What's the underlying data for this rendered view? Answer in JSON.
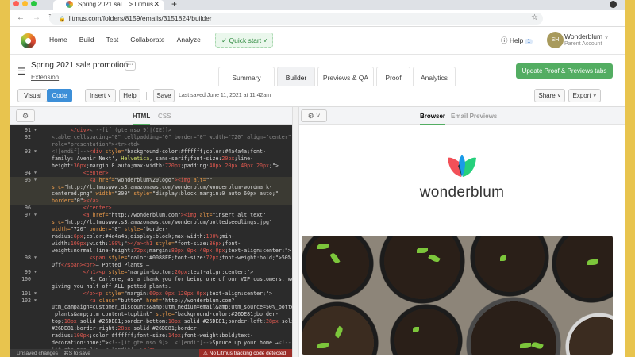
{
  "browser": {
    "tab_title": "Spring 2021 sal... > Litmus",
    "url": "litmus.com/folders/8159/emails/3151824/builder"
  },
  "header": {
    "nav": [
      "Home",
      "Build",
      "Test",
      "Collaborate",
      "Analyze"
    ],
    "quick_start": "Quick start",
    "help": "Help",
    "help_count": "1",
    "avatar_initials": "SH",
    "account_name": "Wonderblum",
    "account_type": "Parent Account"
  },
  "email": {
    "title": "Spring 2021 sale promotion",
    "more": "···",
    "extension": "Extension",
    "tabs": [
      "Summary",
      "Builder",
      "Previews & QA",
      "Proof",
      "Analytics"
    ],
    "active_tab": "Builder",
    "update_button": "Update Proof & Previews tabs"
  },
  "toolbar": {
    "visual": "Visual",
    "code": "Code",
    "insert": "Insert",
    "help": "Help",
    "save": "Save",
    "last_saved": "Last saved June 11, 2021 at 11:42am",
    "share": "Share",
    "export": "Export"
  },
  "editor": {
    "tabs": [
      "HTML",
      "CSS"
    ],
    "active_tab": "HTML",
    "lines": [
      {
        "n": "91",
        "f": true,
        "seg": [
          [
            "p",
            "      "
          ],
          [
            "t",
            "</div>"
          ],
          [
            "c",
            "<!--[if (gte mso 9)|(IE)]>"
          ]
        ]
      },
      {
        "n": "92",
        "seg": [
          [
            "c",
            "<table cellspacing=\"0\" cellpadding=\"0\" border=\"0\" width=\"720\" align=\"center\""
          ]
        ]
      },
      {
        "seg": [
          [
            "c",
            "role=\"presentation\"><tr><td>"
          ]
        ]
      },
      {
        "n": "93",
        "f": true,
        "seg": [
          [
            "c",
            "<![endif]-->"
          ],
          [
            "t",
            "<div "
          ],
          [
            "a",
            "style="
          ],
          [
            "s",
            "\"background-color:#ffffff;color:#4a4a4a;font-"
          ]
        ]
      },
      {
        "seg": [
          [
            "s",
            "family:'Avenir Next', "
          ],
          [
            "g",
            "Helvetica"
          ],
          [
            "s",
            ", sans-serif;font-size:"
          ],
          [
            "v",
            "20px"
          ],
          [
            "s",
            ";line-"
          ]
        ]
      },
      {
        "seg": [
          [
            "s",
            "height:"
          ],
          [
            "v",
            "36px"
          ],
          [
            "s",
            ";margin:0 auto;max-width:"
          ],
          [
            "v",
            "720px"
          ],
          [
            "s",
            ";padding:"
          ],
          [
            "v",
            "40px 20px 40px 20px"
          ],
          [
            "s",
            ";\">"
          ]
        ]
      },
      {
        "n": "94",
        "f": true,
        "seg": [
          [
            "p",
            "          "
          ],
          [
            "t",
            "<center>"
          ]
        ]
      },
      {
        "n": "95",
        "f": true,
        "hl": true,
        "seg": [
          [
            "p",
            "            "
          ],
          [
            "t",
            "<a "
          ],
          [
            "a",
            "href="
          ],
          [
            "s",
            "\"wonderblum%20logo\""
          ],
          [
            "t",
            "><img "
          ],
          [
            "a",
            "alt="
          ],
          [
            "s",
            "\"\""
          ]
        ]
      },
      {
        "hl": true,
        "seg": [
          [
            "a",
            "src="
          ],
          [
            "s",
            "\"http://litmuswww.s3.amazonaws.com/wonderblum/wonderblum-wordmark-"
          ]
        ]
      },
      {
        "hl": true,
        "seg": [
          [
            "s",
            "centered.png\" "
          ],
          [
            "a",
            "width="
          ],
          [
            "s",
            "\"300\" "
          ],
          [
            "a",
            "style="
          ],
          [
            "s",
            "\"display:block;margin:0 auto 60px auto;\""
          ]
        ]
      },
      {
        "hl": true,
        "seg": [
          [
            "a",
            "border="
          ],
          [
            "s",
            "\"0\""
          ],
          [
            "t",
            "></a>"
          ]
        ]
      },
      {
        "n": "96",
        "seg": [
          [
            "p",
            "          "
          ],
          [
            "t",
            "</center>"
          ]
        ]
      },
      {
        "n": "97",
        "f": true,
        "seg": [
          [
            "p",
            "          "
          ],
          [
            "t",
            "<a "
          ],
          [
            "a",
            "href="
          ],
          [
            "s",
            "\"http://wonderblum.com\""
          ],
          [
            "t",
            "><img "
          ],
          [
            "a",
            "alt="
          ],
          [
            "s",
            "\"insert alt text\""
          ]
        ]
      },
      {
        "seg": [
          [
            "a",
            "src="
          ],
          [
            "s",
            "\"http://litmuswww.s3.amazonaws.com/wonderblum/pottedseedlings.jpg\""
          ]
        ]
      },
      {
        "seg": [
          [
            "a",
            "width="
          ],
          [
            "s",
            "\"720\" "
          ],
          [
            "a",
            "border="
          ],
          [
            "s",
            "\"0\" "
          ],
          [
            "a",
            "style="
          ],
          [
            "s",
            "\"border-"
          ]
        ]
      },
      {
        "seg": [
          [
            "s",
            "radius:"
          ],
          [
            "v",
            "6px"
          ],
          [
            "s",
            ";color:#4a4a4a;display:block;max-width:"
          ],
          [
            "v",
            "100%"
          ],
          [
            "s",
            ";min-"
          ]
        ]
      },
      {
        "seg": [
          [
            "s",
            "width:"
          ],
          [
            "v",
            "100px"
          ],
          [
            "s",
            ";width:"
          ],
          [
            "v",
            "100%"
          ],
          [
            "s",
            ";\""
          ],
          [
            "t",
            "></a><h1 "
          ],
          [
            "a",
            "style="
          ],
          [
            "s",
            "\"font-size:"
          ],
          [
            "v",
            "36px"
          ],
          [
            "s",
            ";font-"
          ]
        ]
      },
      {
        "seg": [
          [
            "s",
            "weight:normal;line-height:"
          ],
          [
            "v",
            "72px"
          ],
          [
            "s",
            ";margin:"
          ],
          [
            "v",
            "80px 0px 40px 0px"
          ],
          [
            "s",
            ";text-align:center;\">"
          ]
        ]
      },
      {
        "n": "98",
        "f": true,
        "seg": [
          [
            "p",
            "            "
          ],
          [
            "t",
            "<span "
          ],
          [
            "a",
            "style="
          ],
          [
            "s",
            "\"color:#0088FF;font-size:"
          ],
          [
            "v",
            "72px"
          ],
          [
            "s",
            ";font-weight:bold;\">50%"
          ]
        ]
      },
      {
        "seg": [
          [
            "s",
            "Off"
          ],
          [
            "t",
            "</span><br>"
          ],
          [
            "s",
            "— Potted Plants —"
          ]
        ]
      },
      {
        "n": "99",
        "f": true,
        "seg": [
          [
            "p",
            "          "
          ],
          [
            "t",
            "</h1><p "
          ],
          [
            "a",
            "style="
          ],
          [
            "s",
            "\"margin-bottom:"
          ],
          [
            "v",
            "20px"
          ],
          [
            "s",
            ";text-align:center;\">"
          ]
        ]
      },
      {
        "n": "100",
        "seg": [
          [
            "p",
            "            Hi Carlene, as a thank you for being one of our VIP customers, we're"
          ]
        ]
      },
      {
        "seg": [
          [
            "p",
            "giving you half off ALL potted plants."
          ]
        ]
      },
      {
        "n": "101",
        "f": true,
        "seg": [
          [
            "p",
            "          "
          ],
          [
            "t",
            "</p><p "
          ],
          [
            "a",
            "style="
          ],
          [
            "s",
            "\"margin:"
          ],
          [
            "v",
            "60px 0px 120px 0px"
          ],
          [
            "s",
            ";text-align:center;\">"
          ]
        ]
      },
      {
        "n": "102",
        "f": true,
        "seg": [
          [
            "p",
            "            "
          ],
          [
            "t",
            "<a "
          ],
          [
            "a",
            "class="
          ],
          [
            "s",
            "\"button\" "
          ],
          [
            "a",
            "href="
          ],
          [
            "s",
            "\"http://wonderblum.com?"
          ]
        ]
      },
      {
        "seg": [
          [
            "s",
            "utm_campaign=customer_discounts&amp;utm_medium=email&amp;utm_source=50%_potted"
          ]
        ]
      },
      {
        "seg": [
          [
            "s",
            "_plants&amp;utm_content=toplink\" "
          ],
          [
            "a",
            "style="
          ],
          [
            "s",
            "\"background-color:#26DE81;border-"
          ]
        ]
      },
      {
        "seg": [
          [
            "s",
            "top:"
          ],
          [
            "v",
            "18px"
          ],
          [
            "s",
            " solid #26DE81;border-bottom:"
          ],
          [
            "v",
            "18px"
          ],
          [
            "s",
            " solid #26DE81;border-left:"
          ],
          [
            "v",
            "28px"
          ],
          [
            "s",
            " solid"
          ]
        ]
      },
      {
        "seg": [
          [
            "s",
            "#26DE81;border-right:"
          ],
          [
            "v",
            "28px"
          ],
          [
            "s",
            " solid #26DE81;border-"
          ]
        ]
      },
      {
        "seg": [
          [
            "s",
            "radius:"
          ],
          [
            "v",
            "100px"
          ],
          [
            "s",
            ";color:#ffffff;font-size:"
          ],
          [
            "v",
            "14px"
          ],
          [
            "s",
            ";font-weight:bold;text-"
          ]
        ]
      },
      {
        "seg": [
          [
            "s",
            "decoration:none;\">"
          ],
          [
            "c",
            "<!--[if gte mso 9]>  <![endif]-->"
          ],
          [
            "s",
            "Spruce up your home →"
          ],
          [
            "c",
            "<!--"
          ]
        ]
      },
      {
        "seg": [
          [
            "c",
            "[if gte mso 9]>  <![endif]-->"
          ],
          [
            "t",
            "</a>"
          ]
        ]
      }
    ]
  },
  "status": {
    "unsaved": "Unsaved changes",
    "save_hint": "⌘S to save",
    "warning": "No Litmus tracking code detected"
  },
  "preview": {
    "tabs": [
      "Browser",
      "Email Previews"
    ],
    "active_tab": "Browser",
    "wordmark": "wonderblum"
  },
  "colors": {
    "accent_green": "#53ad62",
    "code_blue": "#3d8fd8",
    "warning_red": "#9c2d28"
  }
}
